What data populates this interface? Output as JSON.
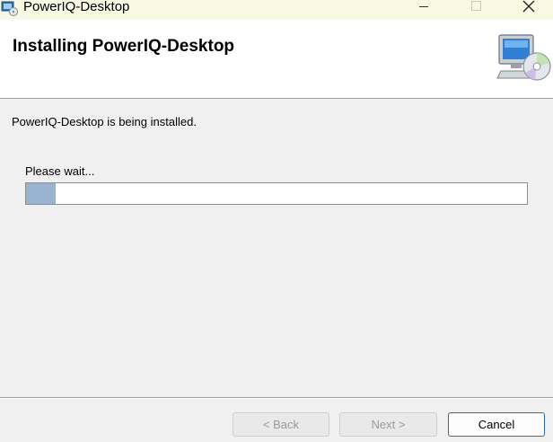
{
  "window": {
    "title": "PowerIQ-Desktop",
    "app_icon": "installer-icon",
    "controls": [
      "minimize-icon",
      "maximize-icon",
      "close-icon"
    ]
  },
  "header": {
    "title": "Installing PowerIQ-Desktop",
    "graphic": "computer-disc-icon"
  },
  "body": {
    "status_text": "PowerIQ-Desktop is being installed.",
    "wait_text": "Please wait...",
    "progress_fraction": 0.06
  },
  "buttons": {
    "back_label": "< Back",
    "next_label": "Next >",
    "cancel_label": "Cancel"
  },
  "colors": {
    "titlebar_bg": "#f7f9e3",
    "progress_fill": "#99b4d1",
    "focus_border": "#2a6fb5"
  }
}
